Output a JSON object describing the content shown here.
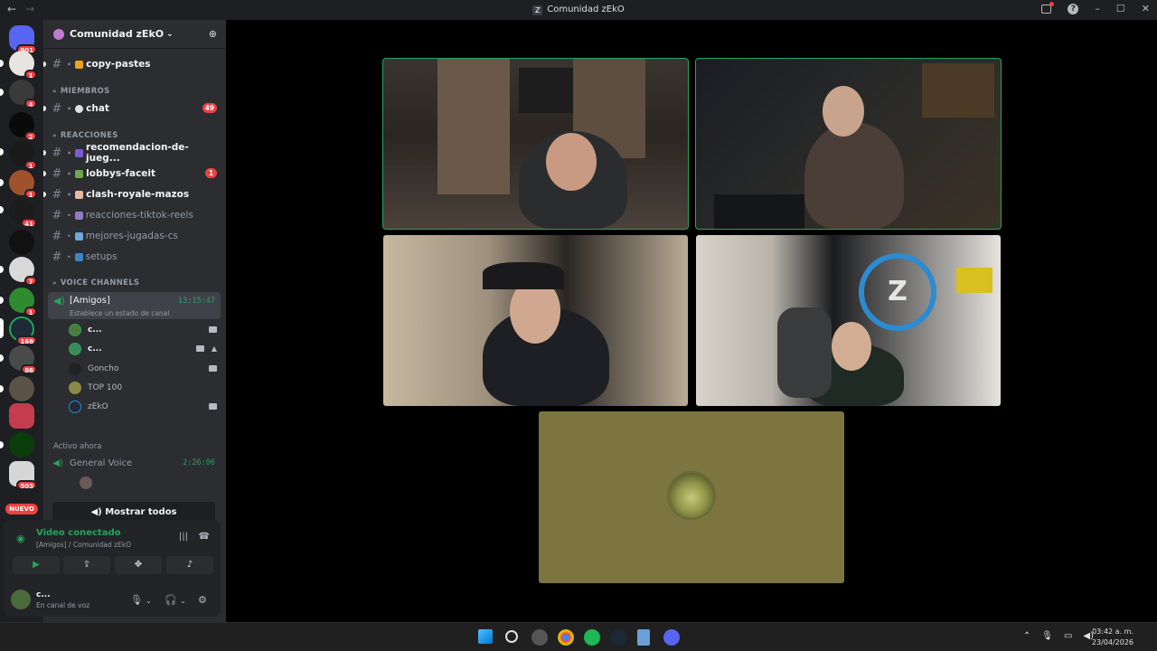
{
  "window": {
    "title": "Comunidad zEkO",
    "nav_back": "←",
    "nav_forward": "→",
    "minimize": "–",
    "maximize": "☐",
    "close": "✕"
  },
  "rail": {
    "badges": [
      "901",
      "1",
      "4",
      "2",
      "1",
      "1",
      "41",
      "7",
      "1",
      "168",
      "86",
      "503"
    ],
    "nuevo_label": "NUEVO"
  },
  "guild": {
    "name": "Comunidad zEkO",
    "chevron": "⌄"
  },
  "channels": [
    {
      "name": "copy-pastes",
      "prefix": "#",
      "unread": true
    },
    {
      "name": "chat",
      "prefix": "#",
      "unread": true,
      "count": "49"
    },
    {
      "name": "recomendacion-de-jueg...",
      "prefix": "#",
      "unread": true
    },
    {
      "name": "lobbys-faceit",
      "prefix": "#",
      "unread": true,
      "count": "1"
    },
    {
      "name": "clash-royale-mazos",
      "prefix": "#",
      "unread": true
    },
    {
      "name": "reacciones-tiktok-reels",
      "prefix": "#",
      "unread": false
    },
    {
      "name": "mejores-jugadas-cs",
      "prefix": "#",
      "unread": false
    },
    {
      "name": "setups",
      "prefix": "#",
      "unread": false
    }
  ],
  "categories": {
    "miembros": "MIEMBROS",
    "reacciones": "REACCIONES",
    "voice": "VOICE CHANNELS"
  },
  "voice_channel": {
    "name": "[Amigos]",
    "time": "13:15:47",
    "status": "Establece un estado de canal"
  },
  "members": [
    {
      "name": "c...",
      "bold": true
    },
    {
      "name": "c...",
      "bold": true
    },
    {
      "name": "Goncho",
      "bold": false
    },
    {
      "name": "TOP 100",
      "bold": false
    },
    {
      "name": "zEkO",
      "bold": false
    }
  ],
  "active_now": {
    "label": "Activo ahora",
    "channel": "General Voice",
    "time": "2:26:06",
    "show_all": "Mostrar todos"
  },
  "voice_panel": {
    "status": "Video conectado",
    "location": "[Amigos] / Comunidad zEkO"
  },
  "user": {
    "name": "c...",
    "status": "En canal de voz"
  },
  "taskbar": {
    "time": "03:42 a. m.",
    "date": "23/04/2026"
  },
  "colors": {
    "accent_green": "#23a55a",
    "badge_red": "#f23f43",
    "sidebar": "#2b2d31",
    "rail": "#1e1f22"
  }
}
